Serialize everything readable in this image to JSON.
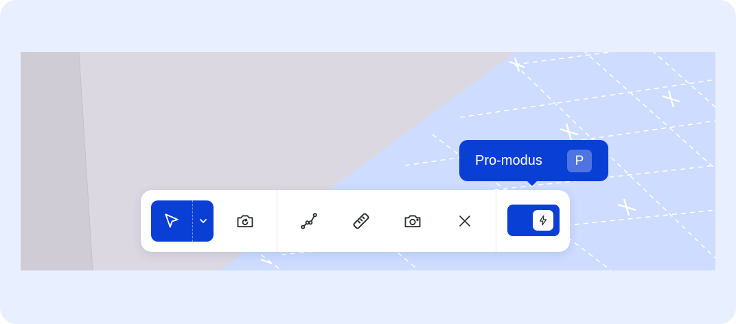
{
  "toolbar": {
    "tools": [
      {
        "name": "select-tool",
        "icon": "cursor-arrow-icon",
        "active": true
      },
      {
        "name": "select-mode-dropdown",
        "icon": "chevron-down-icon"
      },
      {
        "name": "rotate-view-tool",
        "icon": "camera-rotate-icon"
      },
      {
        "name": "polyline-tool",
        "icon": "polyline-icon"
      },
      {
        "name": "measure-tool",
        "icon": "ruler-icon"
      },
      {
        "name": "screenshot-tool",
        "icon": "camera-icon"
      },
      {
        "name": "clear-tool",
        "icon": "close-icon"
      },
      {
        "name": "pro-mode-toggle",
        "icon": "lightning-icon",
        "on": true
      }
    ]
  },
  "tooltip": {
    "label": "Pro-modus",
    "shortcut": "P"
  },
  "colors": {
    "accent": "#0a3fd6",
    "frame_bg": "#e8efff",
    "map_building": "#d9d7e0",
    "map_area": "#cddcff"
  }
}
